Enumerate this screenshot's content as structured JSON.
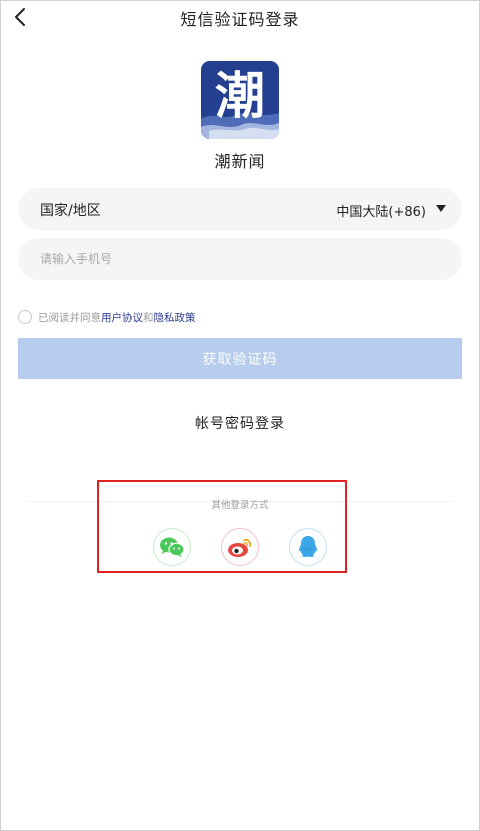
{
  "header": {
    "title": "短信验证码登录",
    "back_icon": "chevron-left-icon"
  },
  "app": {
    "logo_char": "潮",
    "logo_color": "#243f8f",
    "name": "潮新闻"
  },
  "region": {
    "label": "国家/地区",
    "value": "中国大陆(+86)",
    "dropdown_icon": "caret-down-icon"
  },
  "phone": {
    "value": "",
    "placeholder": "请输入手机号"
  },
  "agreement": {
    "checked": false,
    "prefix": "已阅读并同意",
    "terms": "用户协议",
    "and": "和",
    "privacy": "隐私政策",
    "link_color": "#2b3a8e"
  },
  "get_code": {
    "label": "获取验证码",
    "color": "#b6cdee"
  },
  "password_login": {
    "label": "帐号密码登录"
  },
  "other_login": {
    "title": "其他登录方式",
    "providers": [
      {
        "name": "wechat",
        "icon": "wechat-icon",
        "color": "#4cc85a"
      },
      {
        "name": "weibo",
        "icon": "weibo-icon",
        "color": "#e6473c"
      },
      {
        "name": "qq",
        "icon": "qq-icon",
        "color": "#3aa7e8"
      }
    ]
  },
  "highlight_color": "#e02424"
}
